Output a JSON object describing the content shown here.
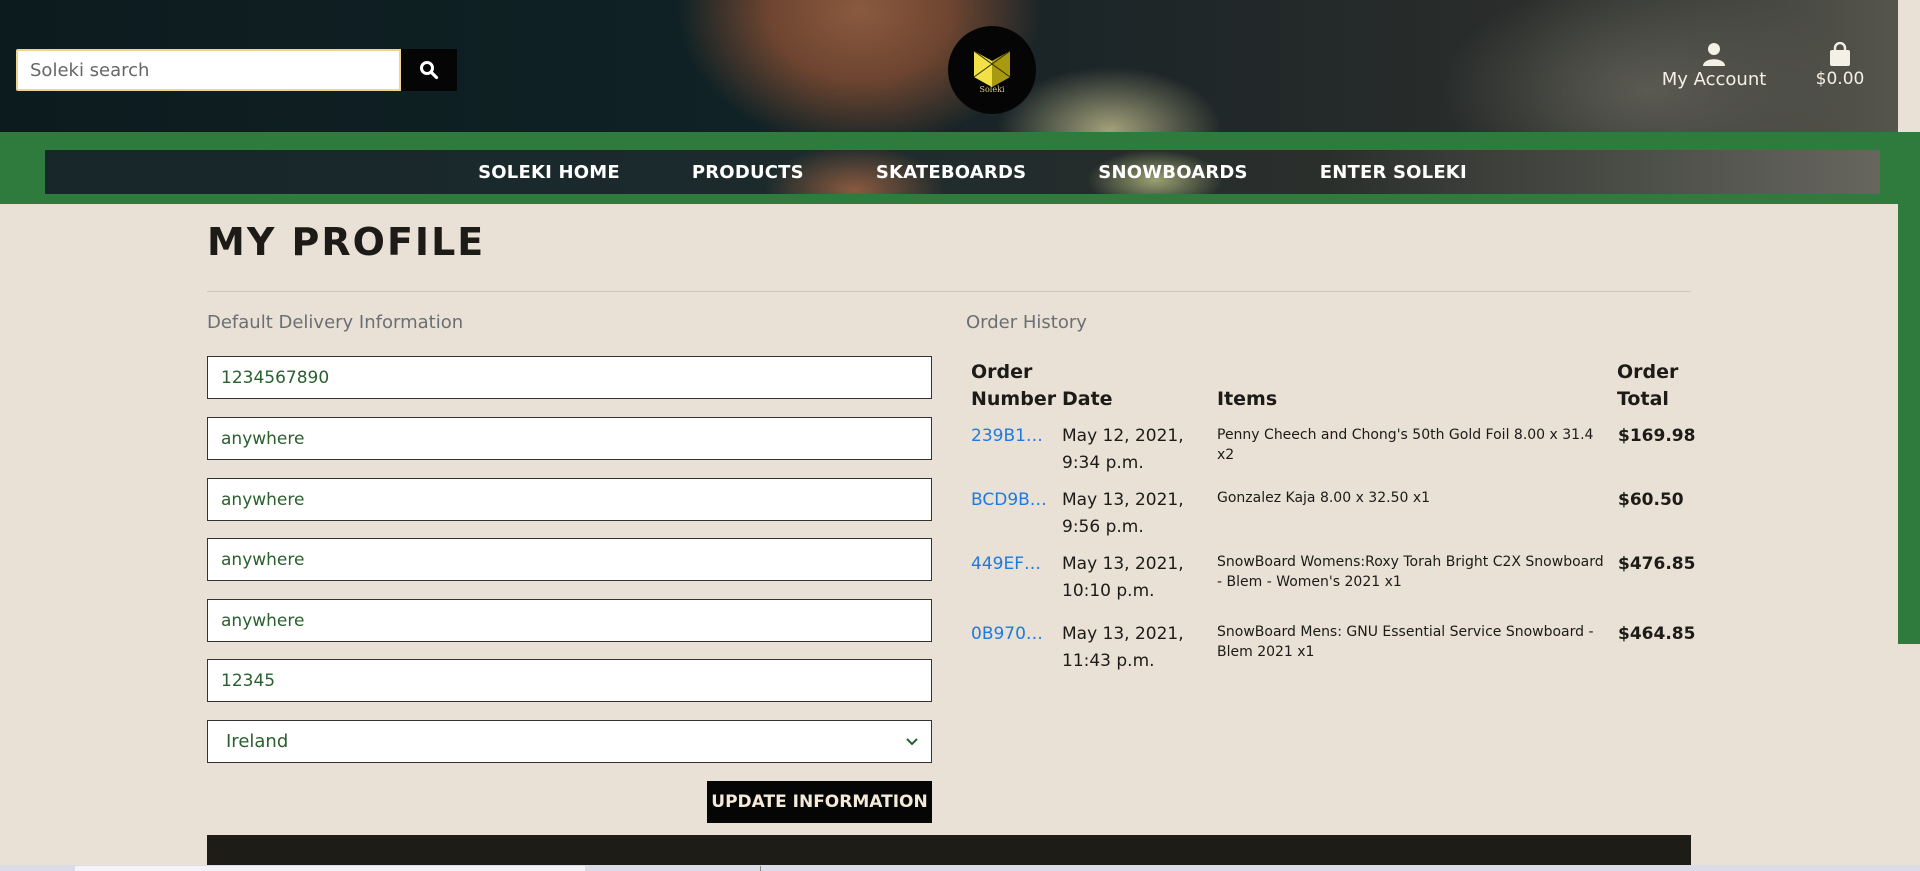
{
  "header": {
    "search": {
      "placeholder": "Soleki search",
      "value": ""
    },
    "logo_text": "Soleki",
    "account_label": "My Account",
    "bag_total": "$0.00"
  },
  "nav": {
    "items": [
      "SOLEKI HOME",
      "PRODUCTS",
      "SKATEBOARDS",
      "SNOWBOARDS",
      "ENTER SOLEKI"
    ]
  },
  "page": {
    "title": "MY PROFILE",
    "delivery_title": "Default Delivery Information",
    "order_history_title": "Order History"
  },
  "delivery": {
    "fields": [
      "1234567890",
      "anywhere",
      "anywhere",
      "anywhere",
      "anywhere",
      "12345"
    ],
    "country": "Ireland",
    "update_label": "UPDATE INFORMATION"
  },
  "orders": {
    "headers": {
      "number_line1": "Order",
      "number_line2": "Number",
      "date": "Date",
      "items": "Items",
      "total_line1": "Order",
      "total_line2": "Total"
    },
    "rows": [
      {
        "number": "239B1…",
        "date_line1": "May 12, 2021,",
        "date_line2": "9:34 p.m.",
        "items": "Penny Cheech and Chong's 50th Gold Foil 8.00 x 31.4 x2",
        "total": "$169.98"
      },
      {
        "number": "BCD9B…",
        "date_line1": "May 13, 2021,",
        "date_line2": "9:56 p.m.",
        "items": "Gonzalez Kaja 8.00 x 32.50 x1",
        "total": "$60.50"
      },
      {
        "number": "449EF…",
        "date_line1": "May 13, 2021,",
        "date_line2": "10:10 p.m.",
        "items": "SnowBoard Womens:Roxy Torah Bright C2X Snowboard - Blem - Women's 2021 x1",
        "total": "$476.85"
      },
      {
        "number": "0B970…",
        "date_line1": "May 13, 2021,",
        "date_line2": "11:43 p.m.",
        "items": "SnowBoard Mens: GNU Essential Service Snowboard - Blem 2021 x1",
        "total": "$464.85"
      }
    ]
  },
  "colors": {
    "background": "#e9e0d6",
    "green": "#2f7a3d",
    "link": "#1f7ae0",
    "field_text": "#2a5f2e"
  }
}
